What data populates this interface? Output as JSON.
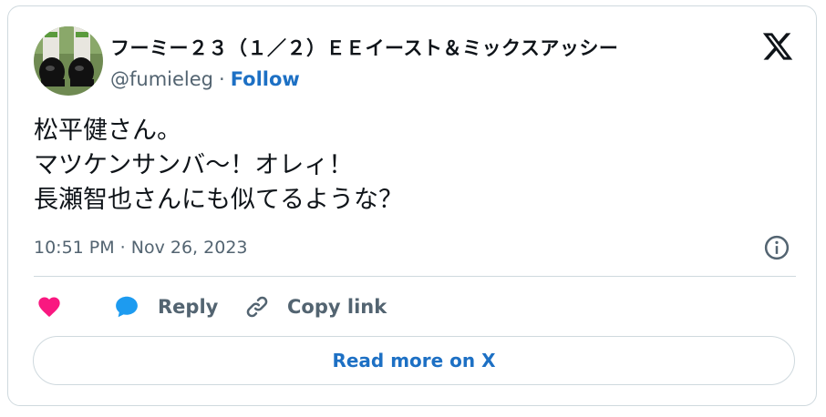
{
  "author": {
    "display_name": "フーミー２３（１／２）ＥＥイースト＆ミックスアッシー",
    "handle": "@fumieleg",
    "separator": "·",
    "follow_label": "Follow"
  },
  "tweet": {
    "lines": [
      "松平健さん。",
      "マツケンサンバ〜！オレィ！",
      "長瀬智也さんにも似てるような？"
    ],
    "timestamp": "10:51 PM · Nov 26, 2023"
  },
  "actions": {
    "like_icon": "heart-icon",
    "reply_label": "Reply",
    "copy_link_label": "Copy link"
  },
  "read_more_label": "Read more on X",
  "colors": {
    "accent": "#1d70c4",
    "like": "#f91880",
    "reply_icon": "#1d9bf0",
    "muted": "#536471",
    "border": "#cfd9de"
  }
}
